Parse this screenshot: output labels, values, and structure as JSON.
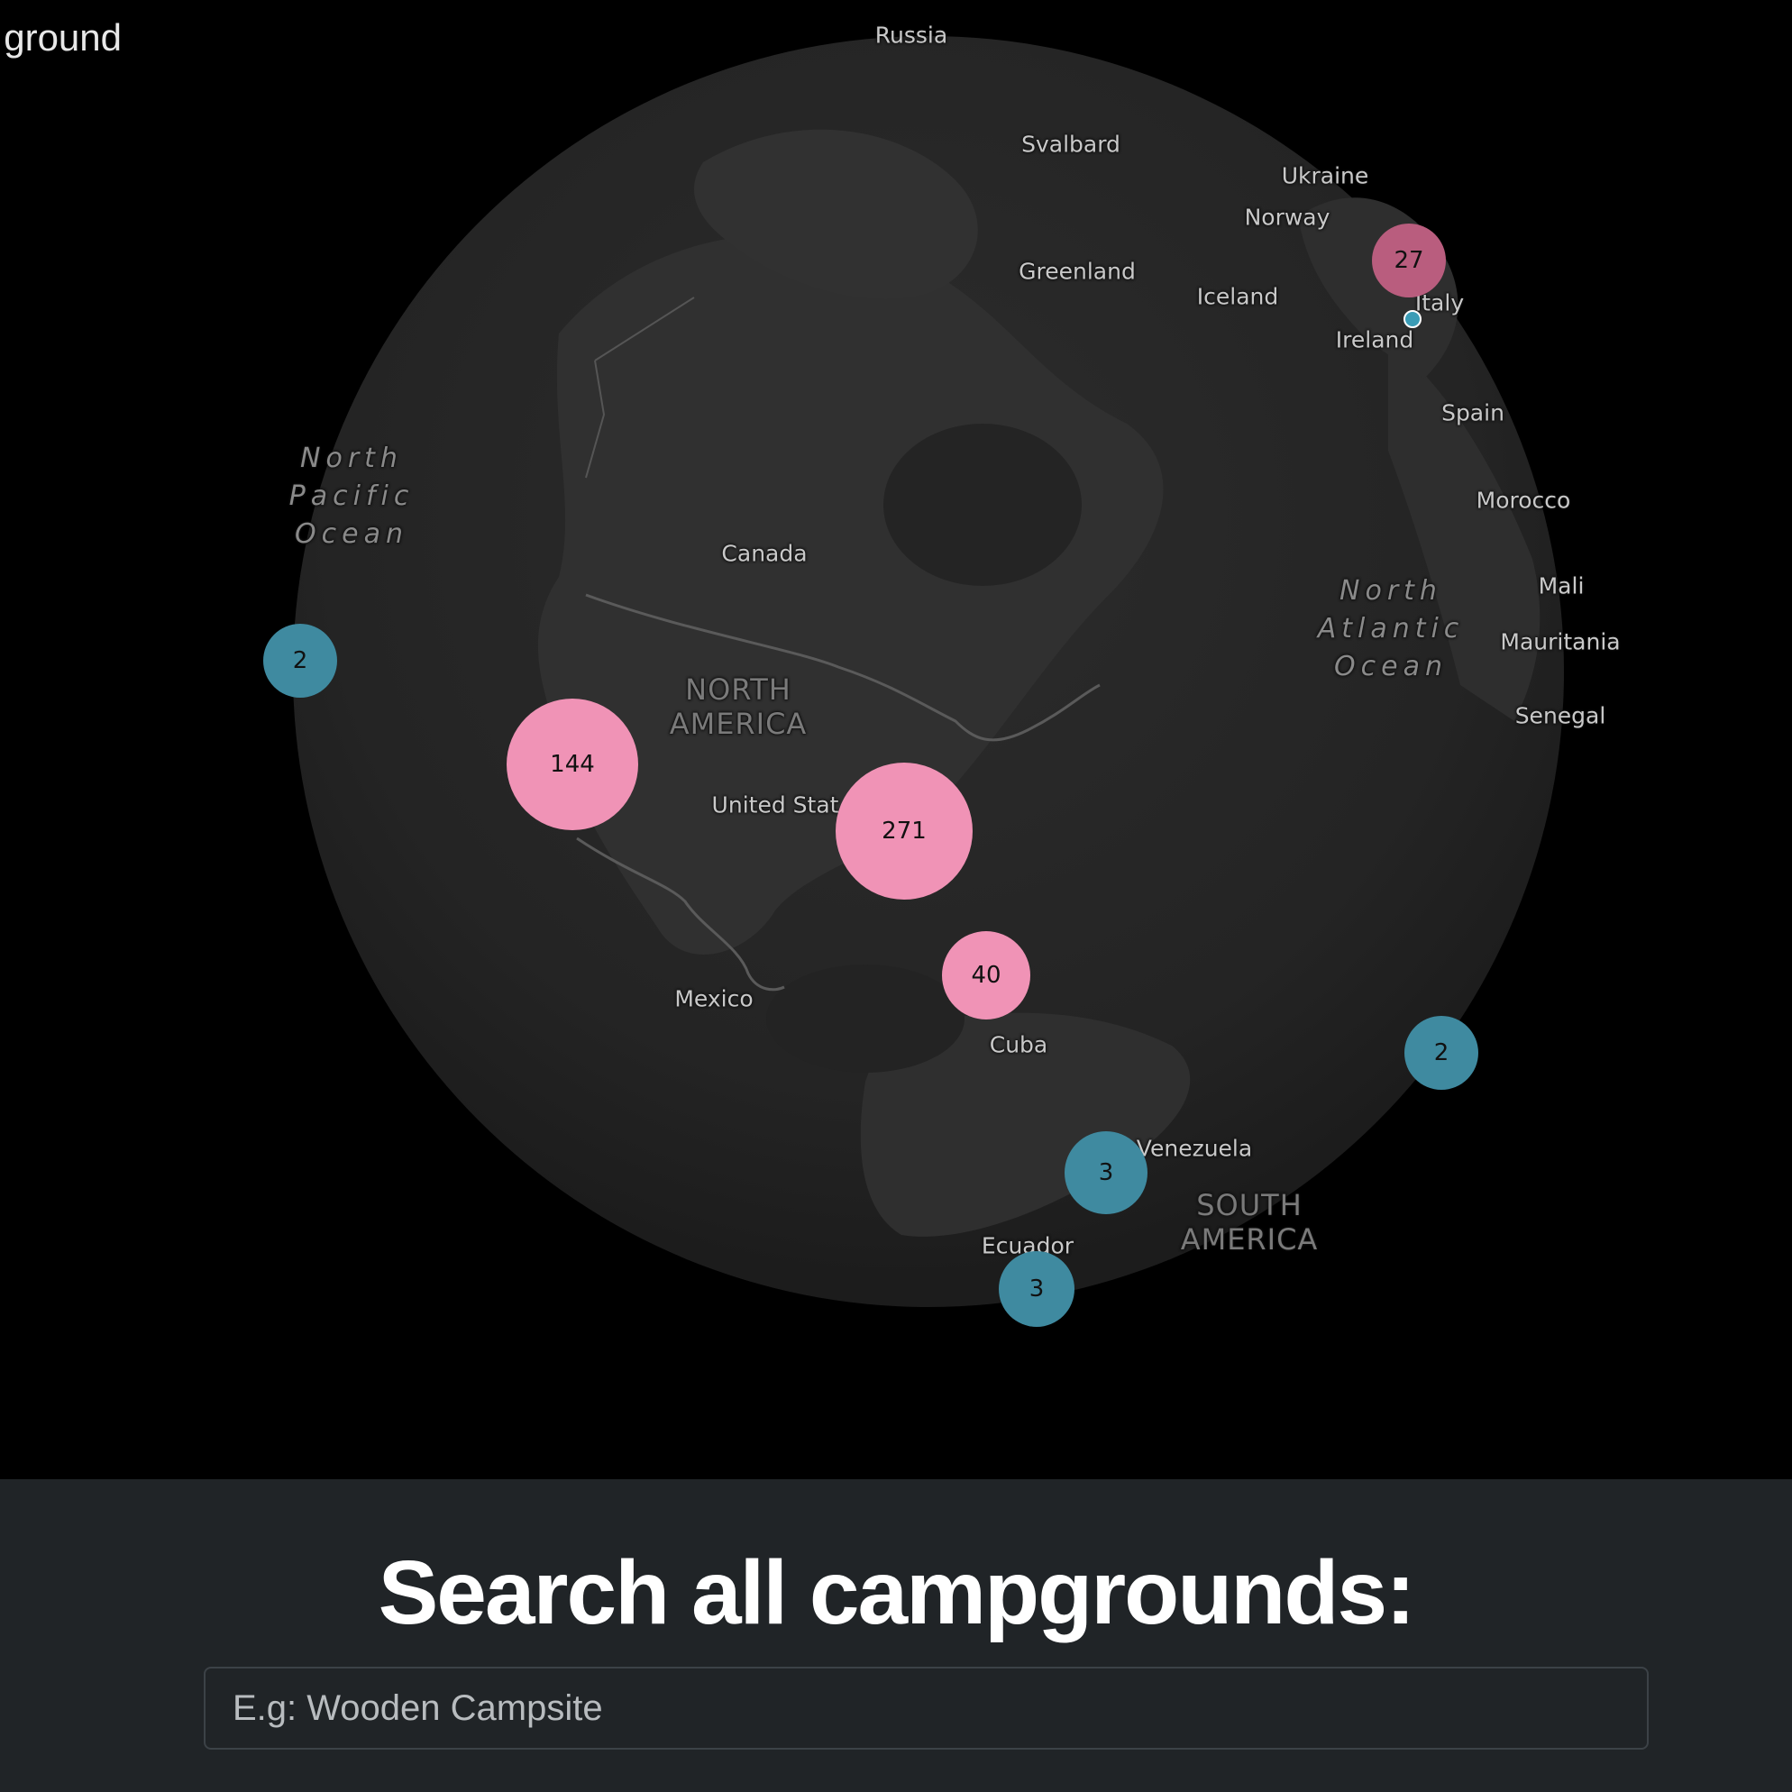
{
  "app": {
    "brand_partial": "ground"
  },
  "map": {
    "country_labels": {
      "russia": "Russia",
      "svalbard": "Svalbard",
      "ukraine": "Ukraine",
      "norway": "Norway",
      "greenland": "Greenland",
      "iceland": "Iceland",
      "italy": "Italy",
      "ireland": "Ireland",
      "spain": "Spain",
      "morocco": "Morocco",
      "mali": "Mali",
      "mauritania": "Mauritania",
      "senegal": "Senegal",
      "canada": "Canada",
      "united_states": "United Stat",
      "mexico": "Mexico",
      "cuba": "Cuba",
      "venezuela": "Venezuela",
      "ecuador": "Ecuador"
    },
    "ocean_labels": {
      "north_pacific": [
        "North",
        "Pacific",
        "Ocean"
      ],
      "north_atlantic": [
        "North",
        "Atlantic",
        "Ocean"
      ]
    },
    "continent_labels": {
      "north_america": [
        "NORTH",
        "AMERICA"
      ],
      "south_america": [
        "SOUTH",
        "AMERICA"
      ]
    },
    "clusters": {
      "europe": "27",
      "pacific": "2",
      "west_us": "144",
      "central_us": "271",
      "florida": "40",
      "atlantic": "2",
      "venezuela": "3",
      "ecuador": "3"
    },
    "colors": {
      "large_cluster": "#f093b6",
      "medium_cluster": "#b95d7e",
      "small_cluster": "#3f8aa0",
      "globe": "#262626"
    }
  },
  "search": {
    "title": "Search all campgrounds:",
    "placeholder": "E.g: Wooden Campsite",
    "value": ""
  }
}
